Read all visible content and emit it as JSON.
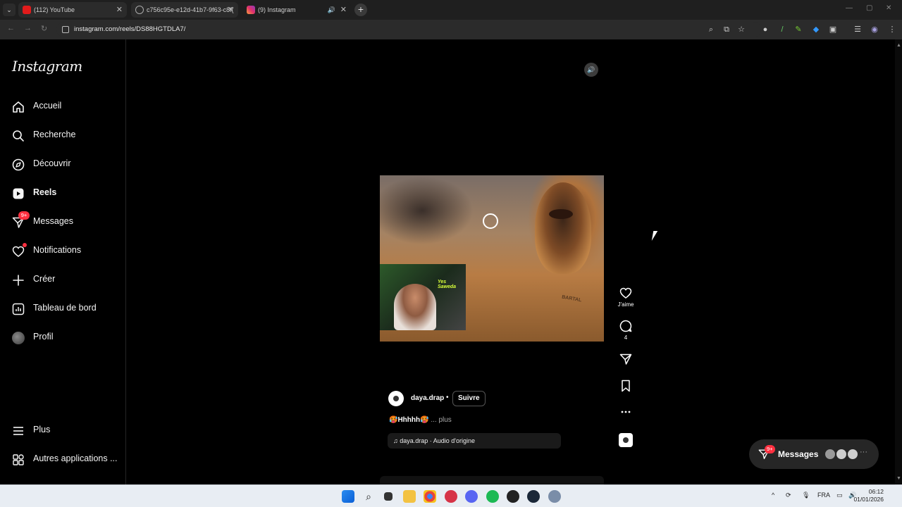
{
  "browser": {
    "tabs": [
      {
        "title": "(112) YouTube"
      },
      {
        "title": "c756c95e-e12d-41b7-9f63-c8f("
      },
      {
        "title": "(9) Instagram"
      }
    ],
    "url": "instagram.com/reels/DS88HGTDLA7/"
  },
  "sidebar": {
    "logo": "Instagram",
    "items": [
      {
        "label": "Accueil",
        "icon": "home-icon"
      },
      {
        "label": "Recherche",
        "icon": "search-icon"
      },
      {
        "label": "Découvrir",
        "icon": "compass-icon"
      },
      {
        "label": "Reels",
        "icon": "reels-icon",
        "active": true
      },
      {
        "label": "Messages",
        "icon": "messages-icon",
        "badge": "9+"
      },
      {
        "label": "Notifications",
        "icon": "heart-icon",
        "dot": true
      },
      {
        "label": "Créer",
        "icon": "plus-icon"
      },
      {
        "label": "Tableau de bord",
        "icon": "chart-icon"
      },
      {
        "label": "Profil",
        "icon": "profile-avatar"
      }
    ],
    "bottom": [
      {
        "label": "Plus",
        "icon": "menu-icon"
      },
      {
        "label": "Autres applications ...",
        "icon": "apps-icon"
      }
    ]
  },
  "reel": {
    "author": "daya.drap",
    "separator": "•",
    "follow": "Suivre",
    "caption_main": "🥵Hhhhh🥵",
    "caption_more": " ... plus",
    "audio": "♫ daya.drap · Audio d'origine",
    "overlay_text": "Yes Saweda",
    "watermark": "BARTAL"
  },
  "actions": {
    "like_label": "J'aime",
    "comments_count": "4"
  },
  "messages_pill": {
    "label": "Messages",
    "badge": "9+"
  },
  "taskbar": {
    "lang": "FRA",
    "time": "06:12",
    "date": "01/01/2026"
  },
  "colors": {
    "background": "#000000",
    "badge": "#ff3040",
    "pill": "#262626"
  }
}
